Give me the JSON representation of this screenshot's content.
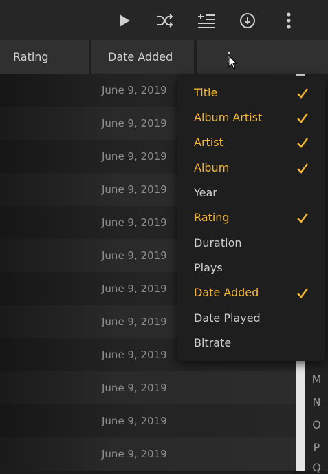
{
  "toolbar": {
    "buttons": [
      {
        "icon": "play-icon"
      },
      {
        "icon": "shuffle-icon"
      },
      {
        "icon": "add-to-queue-icon"
      },
      {
        "icon": "download-icon"
      },
      {
        "icon": "more-vertical-icon"
      }
    ],
    "icon_color": "#d0d0d0"
  },
  "header": {
    "rating_label": "Rating",
    "date_added_label": "Date Added"
  },
  "rows": [
    {
      "date_added": "June 9, 2019"
    },
    {
      "date_added": "June 9, 2019"
    },
    {
      "date_added": "June 9, 2019"
    },
    {
      "date_added": "June 9, 2019"
    },
    {
      "date_added": "June 9, 2019"
    },
    {
      "date_added": "June 9, 2019"
    },
    {
      "date_added": "June 9, 2019"
    },
    {
      "date_added": "June 9, 2019"
    },
    {
      "date_added": "June 9, 2019"
    },
    {
      "date_added": "June 9, 2019"
    },
    {
      "date_added": "June 9, 2019"
    },
    {
      "date_added": "June 9, 2019"
    }
  ],
  "alphabet": [
    "M",
    "N",
    "O",
    "P",
    "Q"
  ],
  "column_menu": {
    "accent_color": "#f5b731",
    "items": [
      {
        "label": "Title",
        "checked": true
      },
      {
        "label": "Album Artist",
        "checked": true
      },
      {
        "label": "Artist",
        "checked": true
      },
      {
        "label": "Album",
        "checked": true
      },
      {
        "label": "Year",
        "checked": false
      },
      {
        "label": "Rating",
        "checked": true
      },
      {
        "label": "Duration",
        "checked": false
      },
      {
        "label": "Plays",
        "checked": false
      },
      {
        "label": "Date Added",
        "checked": true
      },
      {
        "label": "Date Played",
        "checked": false
      },
      {
        "label": "Bitrate",
        "checked": false
      }
    ]
  }
}
